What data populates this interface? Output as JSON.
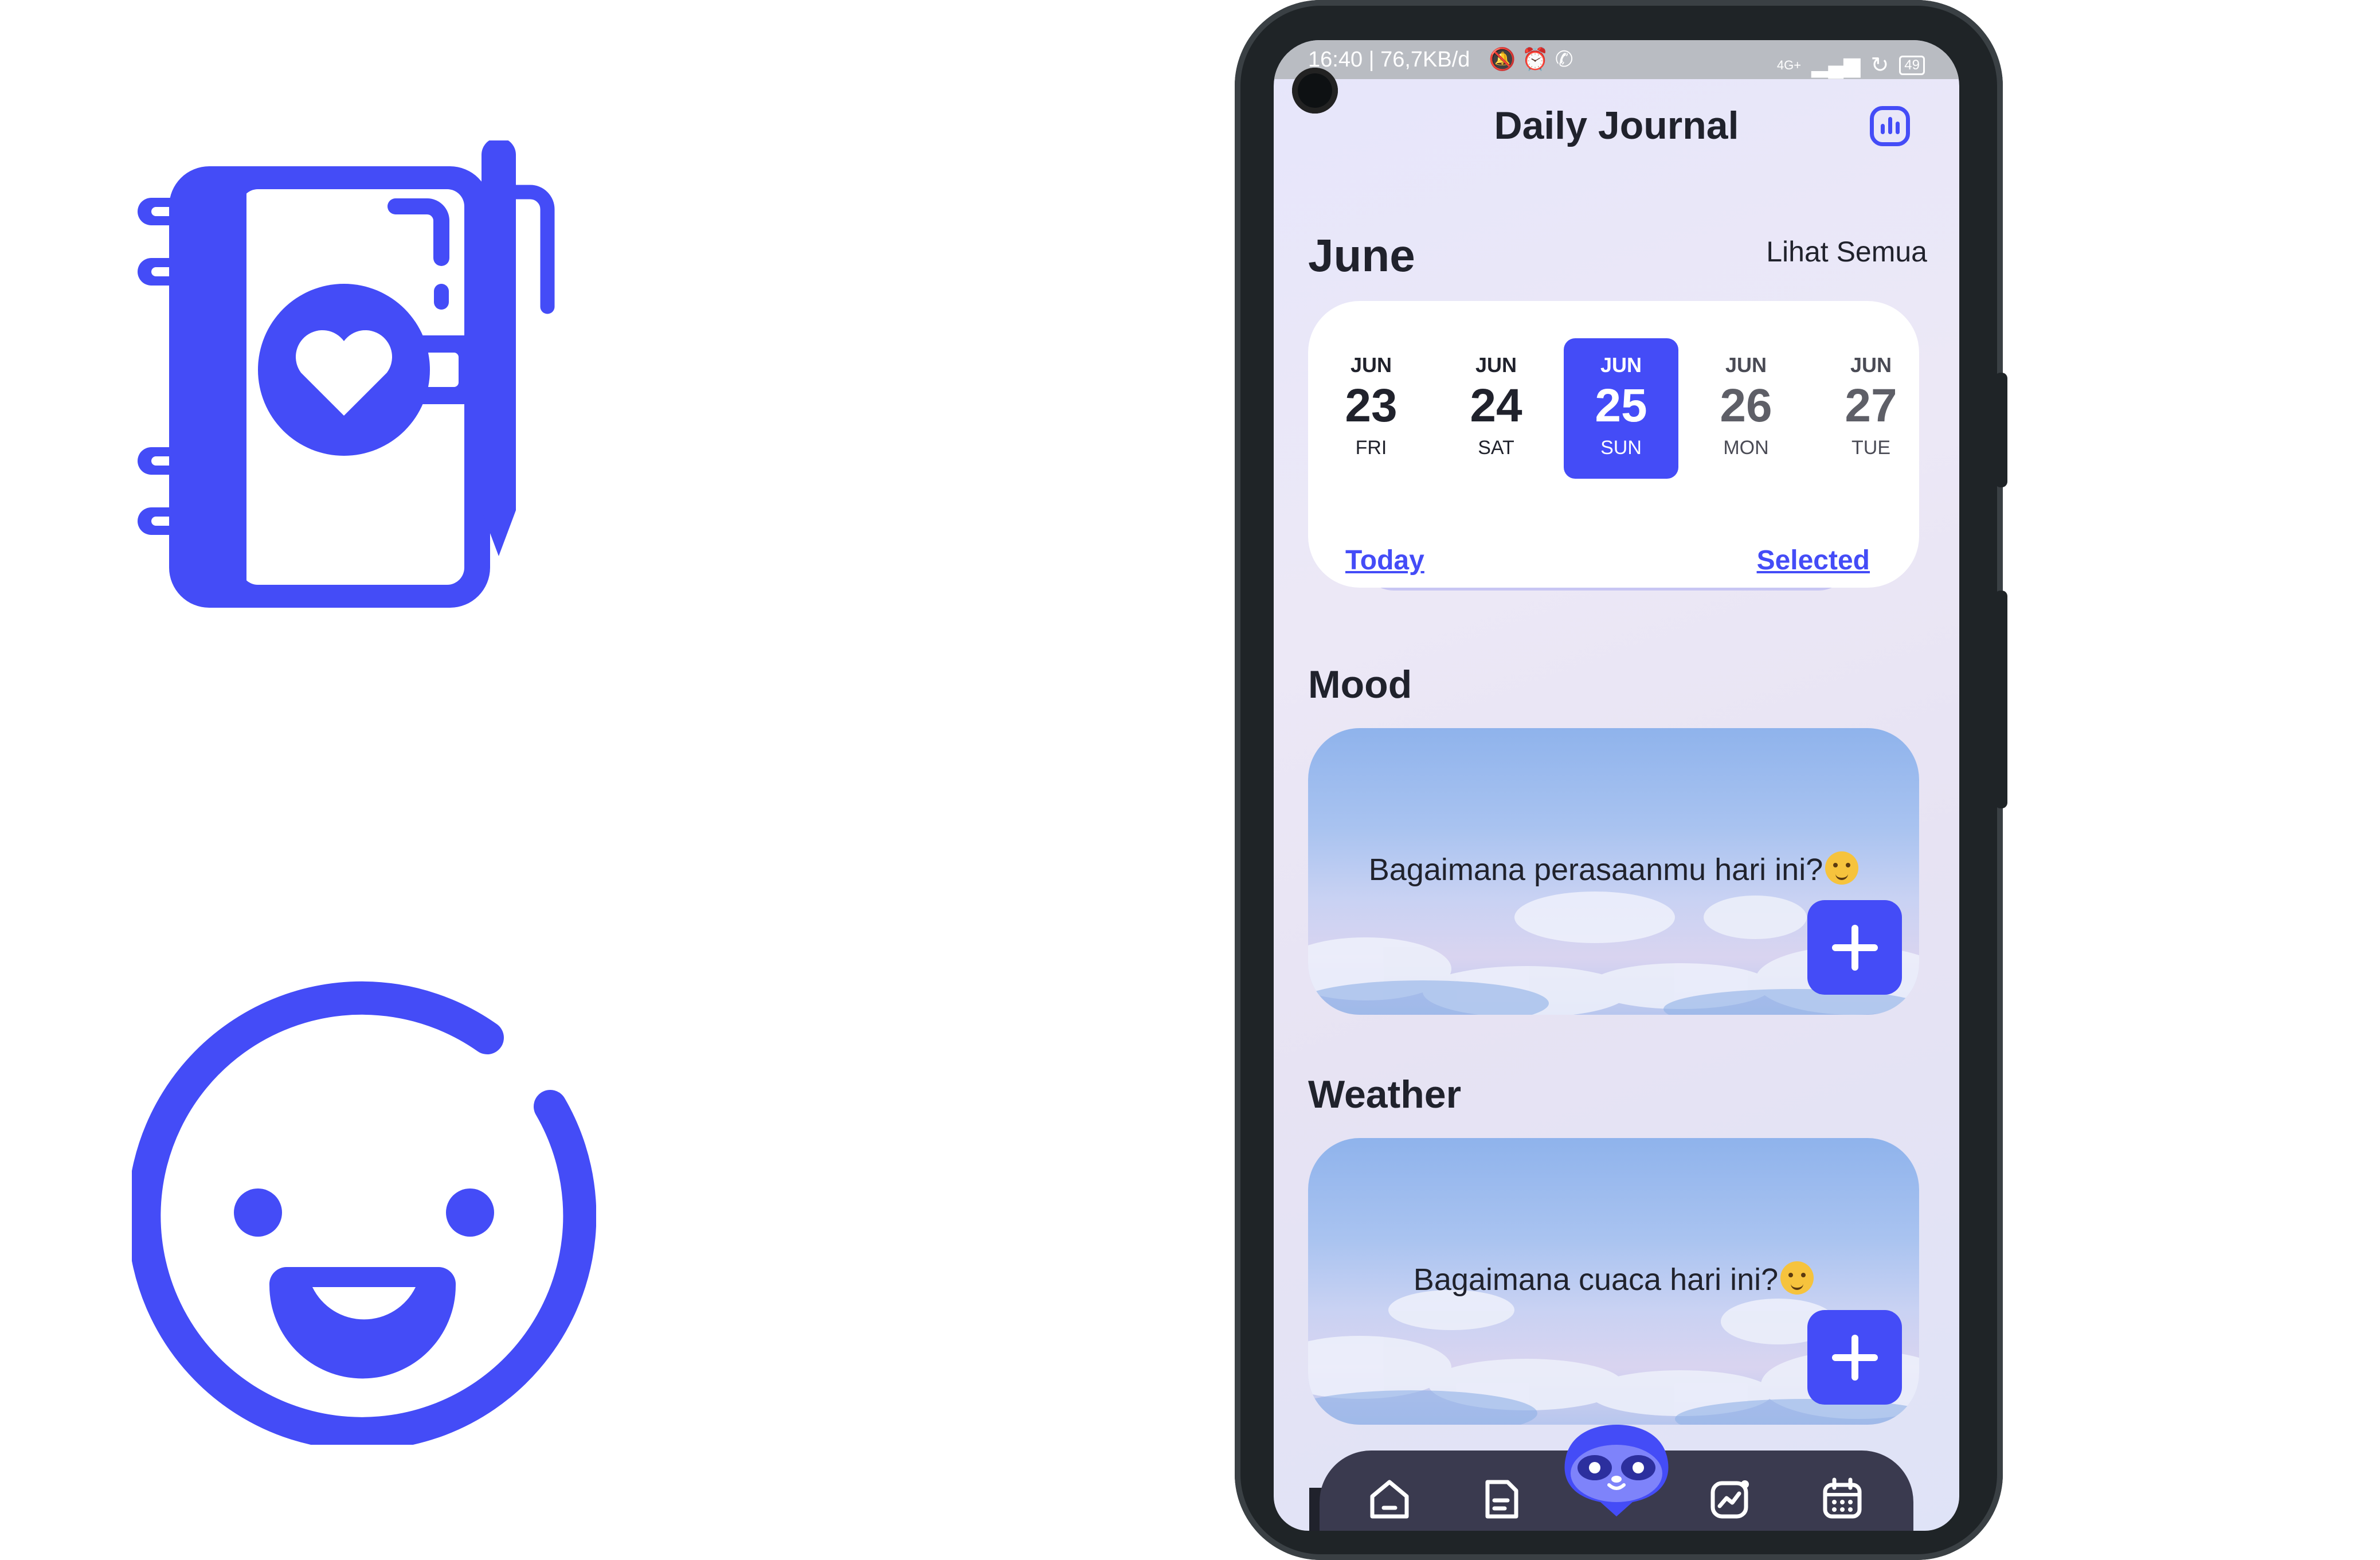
{
  "status_bar": {
    "left_text": "16:40 | 76,7KB/d",
    "network": "4G+",
    "battery": "49"
  },
  "header": {
    "title": "Daily Journal",
    "stats_icon": "chart-icon"
  },
  "calendar": {
    "month": "June",
    "see_all_label": "Lihat Semua",
    "days": [
      {
        "month": "JUN",
        "day": "23",
        "weekday": "FRI"
      },
      {
        "month": "JUN",
        "day": "24",
        "weekday": "SAT"
      },
      {
        "month": "JUN",
        "day": "25",
        "weekday": "SUN"
      },
      {
        "month": "JUN",
        "day": "26",
        "weekday": "MON"
      },
      {
        "month": "JUN",
        "day": "27",
        "weekday": "TUE"
      }
    ],
    "selected_index": 2,
    "today_label": "Today",
    "selected_label": "Selected"
  },
  "mood": {
    "heading": "Mood",
    "question": "Bagaimana perasaanmu hari ini?",
    "add_icon": "plus-icon"
  },
  "weather": {
    "heading": "Weather",
    "question": "Bagaimana cuaca hari ini?",
    "add_icon": "plus-icon"
  },
  "bottom_nav": {
    "items": [
      "home-icon",
      "journal-icon",
      "mascot-icon",
      "stats-icon",
      "calendar-icon"
    ]
  },
  "colors": {
    "accent": "#444cf7",
    "text": "#20222c",
    "nav_bg": "#3a3a4f"
  },
  "decor": {
    "left_top_icon": "journal-heart-pen-icon",
    "left_bottom_icon": "smiley-icon"
  }
}
